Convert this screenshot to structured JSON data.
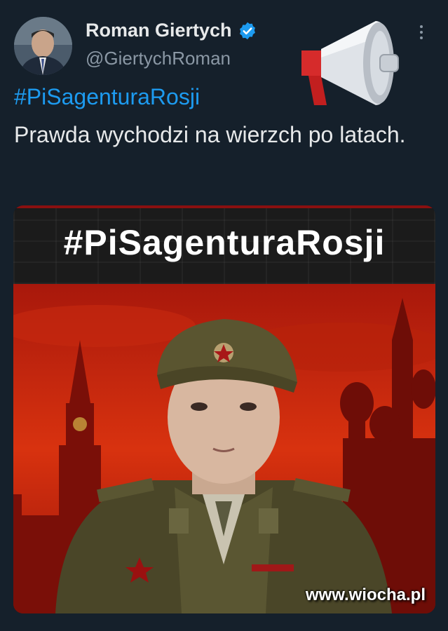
{
  "tweet": {
    "author_name": "Roman Giertych",
    "author_handle": "@GiertychRoman",
    "hashtag": "#PiSagenturaRosji",
    "text": "Prawda wychodzi na wierzch po latach."
  },
  "media": {
    "banner_text": "#PiSagenturaRosji"
  },
  "watermark": "www.wiocha.pl",
  "colors": {
    "background": "#15202b",
    "link": "#1d9bf0",
    "verified": "#1d9bf0",
    "banner_red": "#c0180c"
  },
  "icons": [
    "verified-badge-icon",
    "more-options-icon",
    "megaphone-icon"
  ]
}
